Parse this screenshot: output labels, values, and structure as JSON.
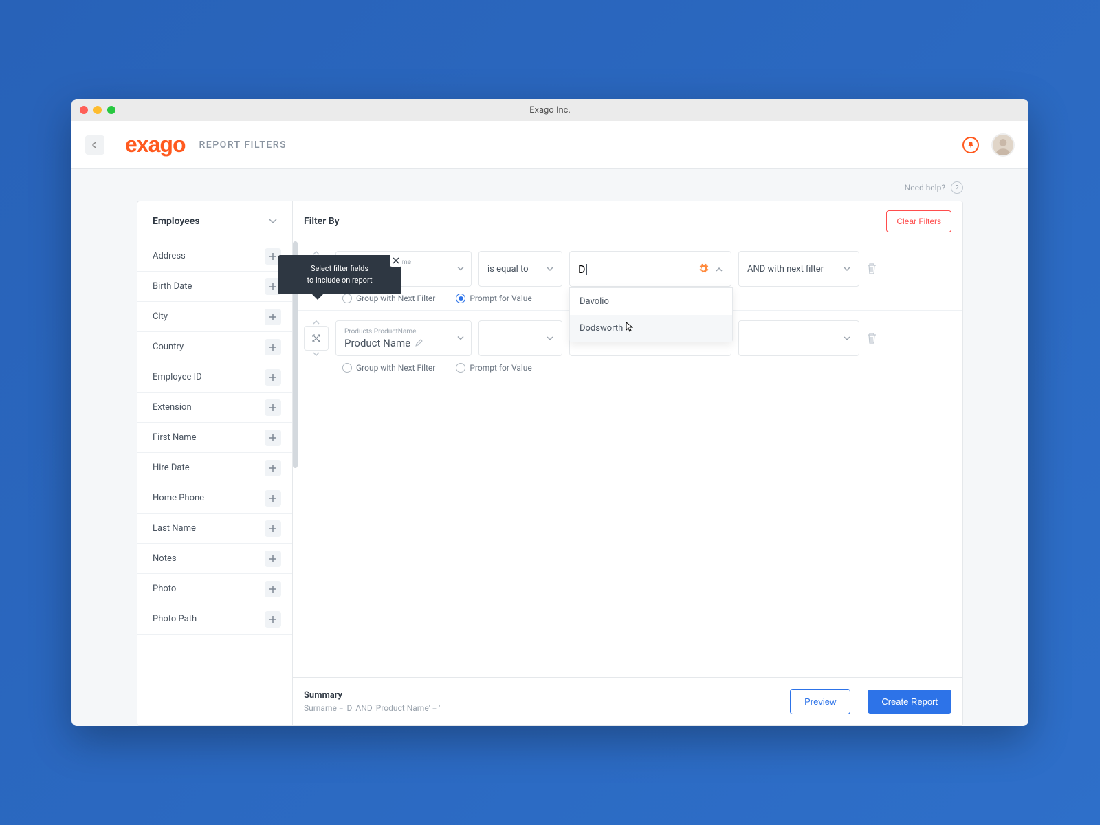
{
  "window": {
    "title": "Exago Inc."
  },
  "header": {
    "logo": "exago",
    "page_title": "REPORT FILTERS"
  },
  "help": {
    "label": "Need help?"
  },
  "tooltip": {
    "line1": "Select filter fields",
    "line2": "to include on report"
  },
  "sidebar": {
    "category": "Employees",
    "fields": [
      "Address",
      "Birth Date",
      "City",
      "Country",
      "Employee ID",
      "Extension",
      "First Name",
      "Hire Date",
      "Home Phone",
      "Last Name",
      "Notes",
      "Photo",
      "Photo Path"
    ]
  },
  "main": {
    "title": "Filter By",
    "clear_label": "Clear Filters"
  },
  "filters": [
    {
      "source": "Employees.LastName",
      "alias": "Surname",
      "operator": "is equal to",
      "value": "D",
      "logic": "AND with next filter",
      "group_checked": false,
      "prompt_checked": true,
      "group_label": "Group with Next Filter",
      "prompt_label": "Prompt for Value",
      "suggestions": [
        "Davolio",
        "Dodsworth"
      ]
    },
    {
      "source": "Products.ProductName",
      "alias": "Product Name",
      "operator": "",
      "value": "",
      "logic": "",
      "group_checked": false,
      "prompt_checked": false,
      "group_label": "Group with Next Filter",
      "prompt_label": "Prompt for Value"
    }
  ],
  "footer": {
    "summary_title": "Summary",
    "summary_text": "Surname = 'D' AND 'Product Name' = '",
    "preview_label": "Preview",
    "create_label": "Create Report"
  }
}
